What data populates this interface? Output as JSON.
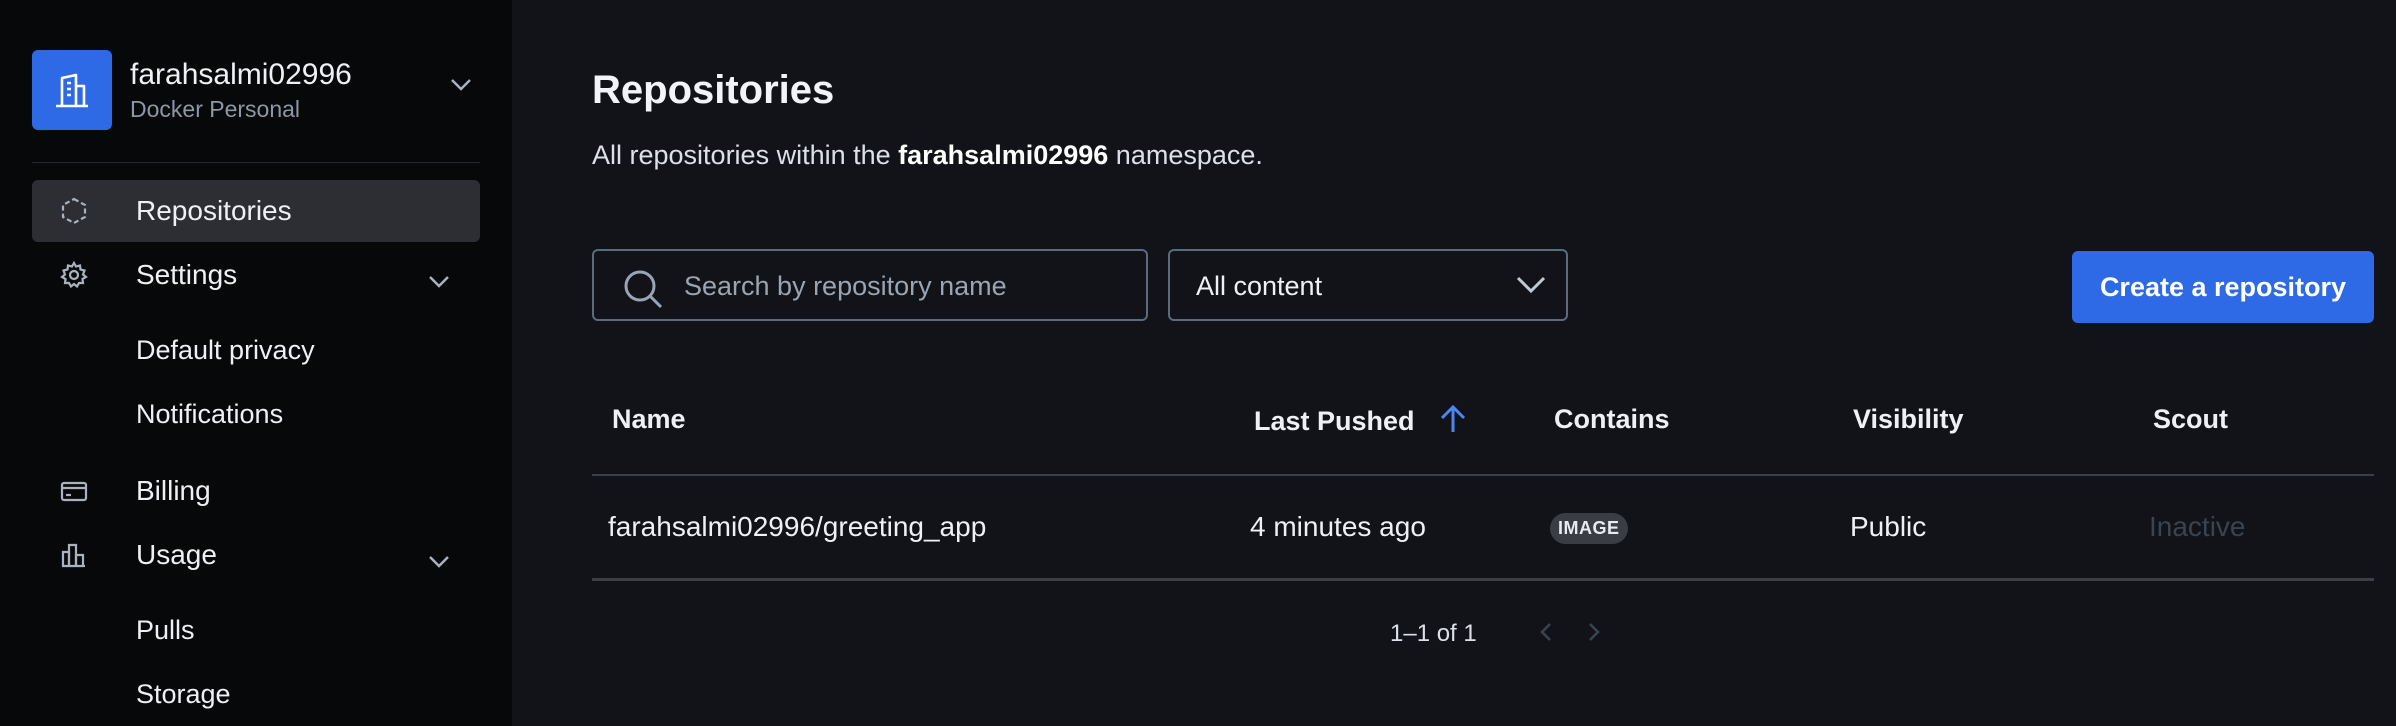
{
  "account": {
    "name": "farahsalmi02996",
    "type": "Docker Personal"
  },
  "sidebar": {
    "items": [
      {
        "label": "Repositories",
        "icon": "cube-icon",
        "active": true
      },
      {
        "label": "Settings",
        "icon": "gear-icon",
        "expandable": true
      },
      {
        "label": "Billing",
        "icon": "credit-card-icon"
      },
      {
        "label": "Usage",
        "icon": "bar-chart-icon",
        "expandable": true
      }
    ],
    "settings_sub": [
      "Default privacy",
      "Notifications"
    ],
    "usage_sub": [
      "Pulls",
      "Storage"
    ]
  },
  "page": {
    "title": "Repositories",
    "subtitle_prefix": "All repositories within the ",
    "subtitle_namespace": "farahsalmi02996",
    "subtitle_suffix": " namespace."
  },
  "filters": {
    "search_placeholder": "Search by repository name",
    "content_value": "All content"
  },
  "create_button": "Create a repository",
  "table": {
    "headers": [
      "Name",
      "Last Pushed",
      "Contains",
      "Visibility",
      "Scout"
    ],
    "sort": {
      "column": "Last Pushed",
      "direction": "up"
    },
    "rows": [
      {
        "name": "farahsalmi02996/greeting_app",
        "last_pushed": "4 minutes ago",
        "contains": "IMAGE",
        "visibility": "Public",
        "scout": "Inactive"
      }
    ]
  },
  "pagination": {
    "text": "1–1 of 1"
  },
  "colors": {
    "accent": "#2f6ae6",
    "background": "#111318",
    "sidebar": "#07080a"
  }
}
